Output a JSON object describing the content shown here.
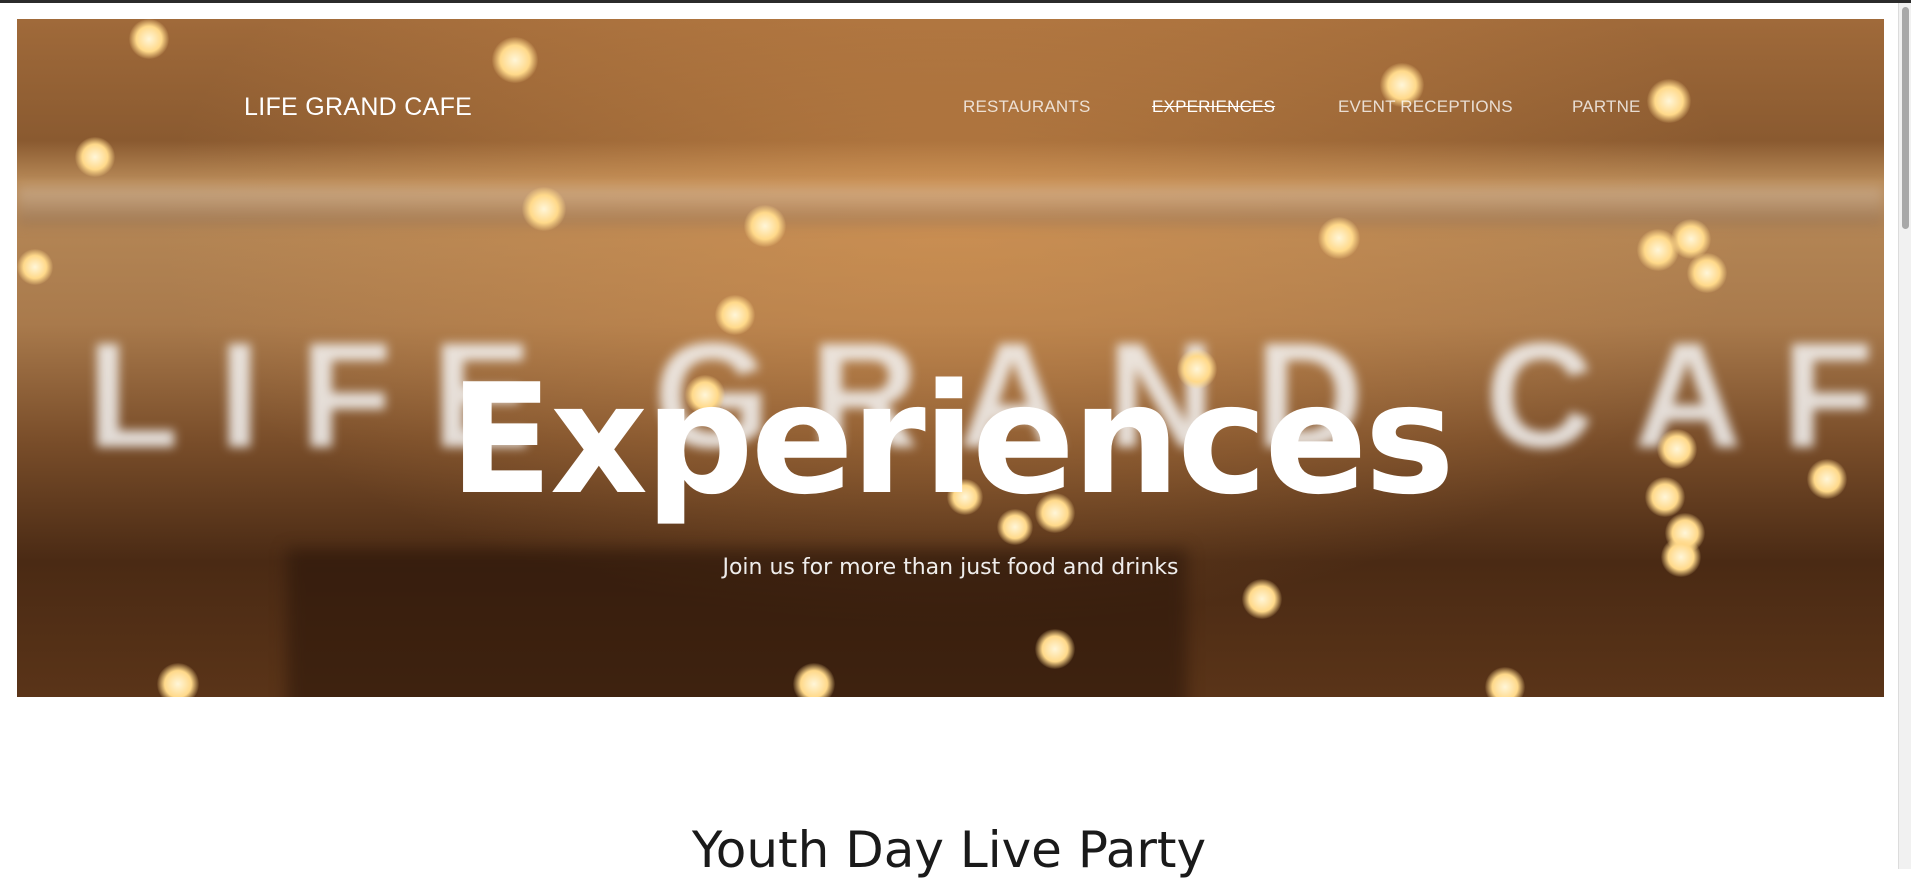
{
  "header": {
    "brand": "LIFE GRAND CAFE",
    "nav": [
      {
        "label": "RESTAURANTS"
      },
      {
        "label": "EXPERIENCES",
        "active": true
      },
      {
        "label": "EVENT RECEPTIONS"
      },
      {
        "label": "PARTNE"
      }
    ]
  },
  "hero": {
    "sign_text": "LIFE GRAND CAFE",
    "title": "Experiences",
    "subtitle": "Join us for more than just food and drinks"
  },
  "section": {
    "title": "Youth Day Live Party"
  },
  "colors": {
    "hero_text": "#ffffff",
    "page_background": "#ffffff",
    "section_text": "#1a1a1a"
  }
}
